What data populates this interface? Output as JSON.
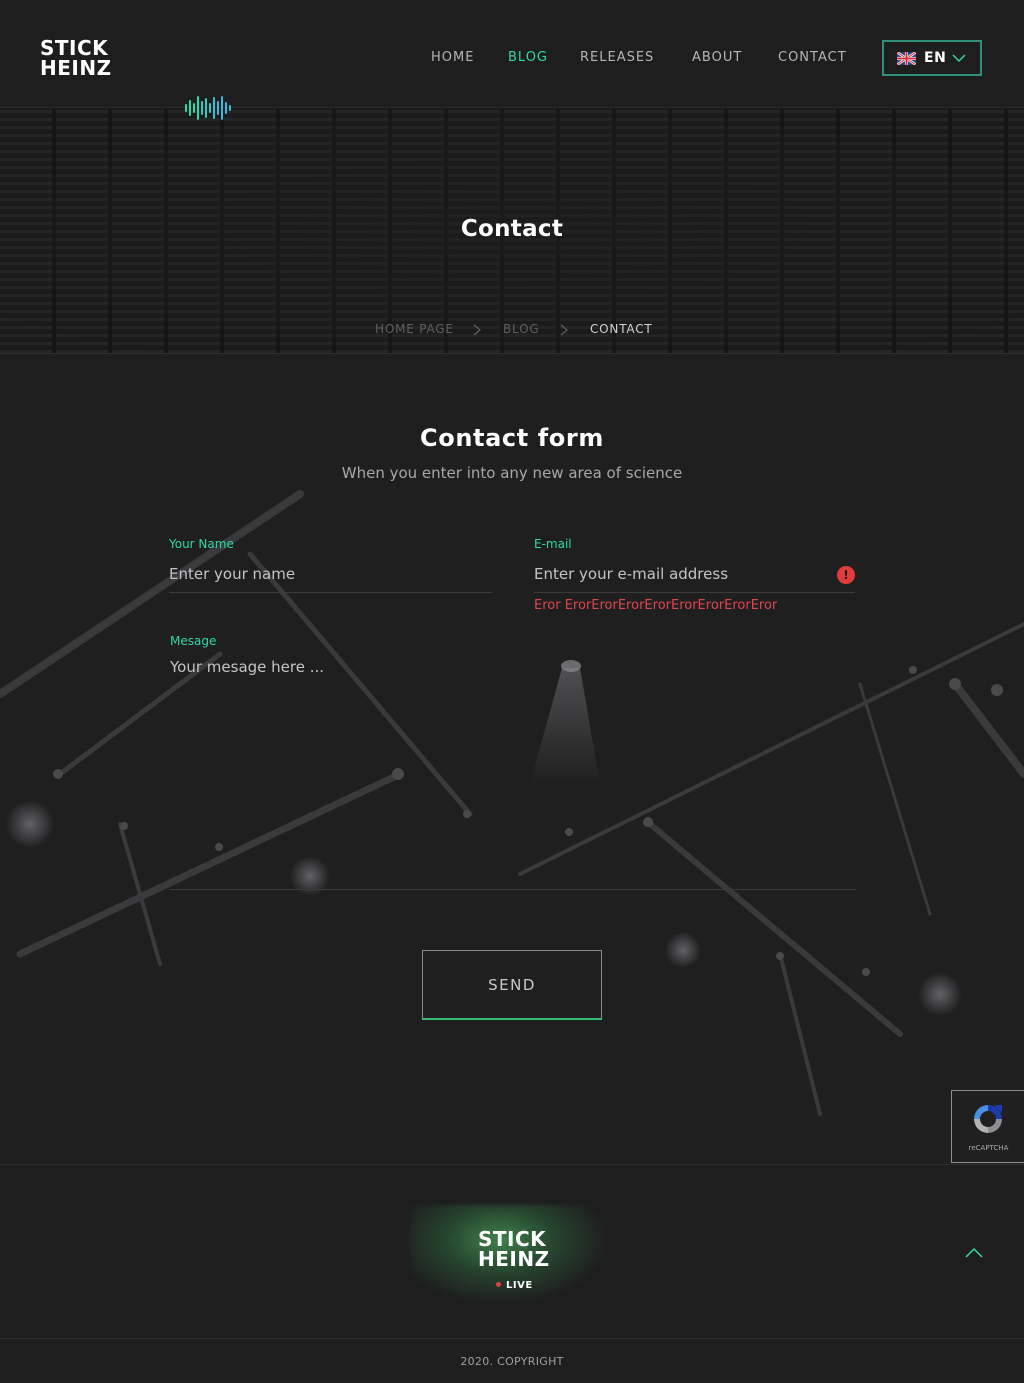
{
  "brand": {
    "line1": "STICK",
    "line2": "HEINZ"
  },
  "nav": {
    "items": [
      {
        "label": "HOME"
      },
      {
        "label": "BLOG"
      },
      {
        "label": "RELEASES"
      },
      {
        "label": "ABOUT"
      },
      {
        "label": "CONTACT"
      }
    ],
    "active": "BLOG"
  },
  "language": {
    "label": "EN",
    "flag_icon": "uk-flag-icon"
  },
  "hero": {
    "title": "Contact",
    "breadcrumb": [
      {
        "label": "HOME PAGE"
      },
      {
        "label": "BLOG"
      },
      {
        "label": "CONTACT"
      }
    ]
  },
  "form": {
    "title": "Contact form",
    "subtitle": "When you enter into any new area of science",
    "name": {
      "label": "Your Name",
      "placeholder": "Enter your name"
    },
    "email": {
      "label": "E-mail",
      "placeholder": "Enter your e-mail address",
      "error": "Eror ErorErorErorErorErorErorErorEror"
    },
    "message": {
      "label": "Mesage",
      "placeholder": "Your mesage here ..."
    },
    "send_label": "SEND"
  },
  "recaptcha": {
    "label": "reCAPTCHA"
  },
  "footer": {
    "brand_line1": "STICK",
    "brand_line2": "HEINZ",
    "live_label": "LIVE",
    "copyright": "2020. COPYRIGHT"
  },
  "colors": {
    "accent": "#2fd9a4",
    "error": "#e0454b",
    "background": "#1e1e1f",
    "live_dot": "#e2403f"
  }
}
